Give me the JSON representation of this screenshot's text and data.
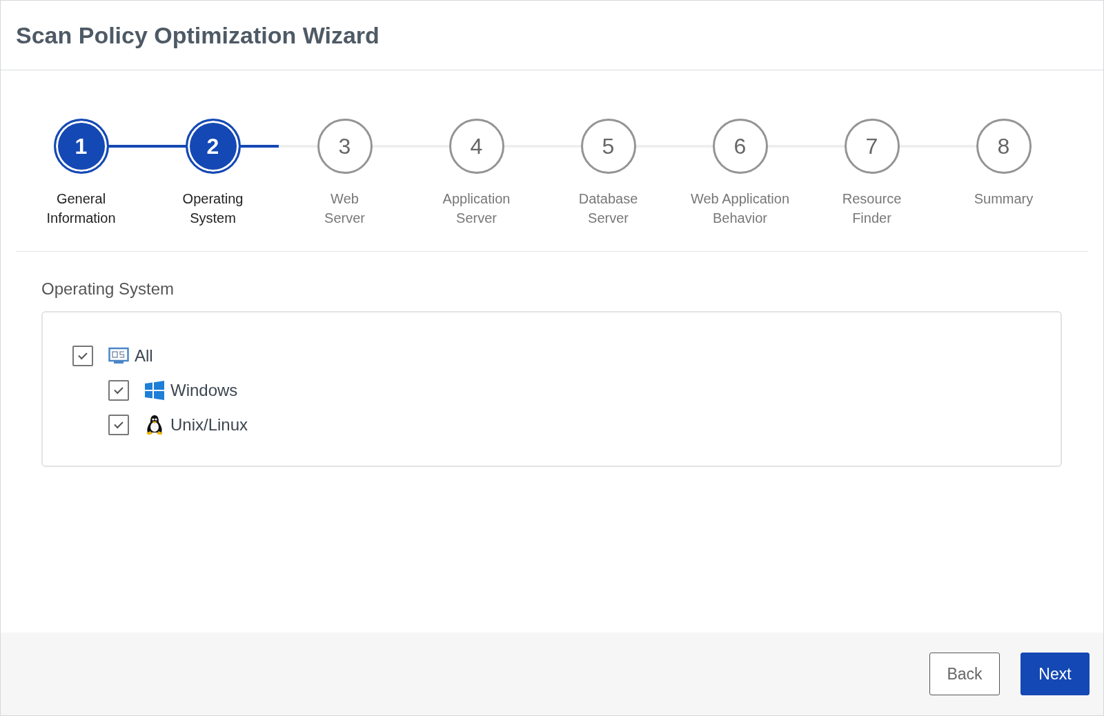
{
  "title": "Scan Policy Optimization Wizard",
  "steps": [
    {
      "number": "1",
      "label": [
        "General",
        "Information"
      ],
      "completed": true
    },
    {
      "number": "2",
      "label": [
        "Operating",
        "System"
      ],
      "completed": true
    },
    {
      "number": "3",
      "label": [
        "Web",
        "Server"
      ],
      "completed": false
    },
    {
      "number": "4",
      "label": [
        "Application",
        "Server"
      ],
      "completed": false
    },
    {
      "number": "5",
      "label": [
        "Database",
        "Server"
      ],
      "completed": false
    },
    {
      "number": "6",
      "label": [
        "Web Application",
        "Behavior"
      ],
      "completed": false
    },
    {
      "number": "7",
      "label": [
        "Resource",
        "Finder"
      ],
      "completed": false
    },
    {
      "number": "8",
      "label": [
        "Summary"
      ],
      "completed": false
    }
  ],
  "section_title": "Operating System",
  "tree": [
    {
      "label": "All",
      "kind": "os",
      "checked": true,
      "children": [
        {
          "label": "Windows",
          "kind": "windows",
          "checked": true
        },
        {
          "label": "Unix/Linux",
          "kind": "linux",
          "checked": true
        }
      ]
    }
  ],
  "buttons": [
    {
      "label": "Back",
      "kind": "secondary"
    },
    {
      "label": "Next",
      "kind": "primary"
    }
  ]
}
